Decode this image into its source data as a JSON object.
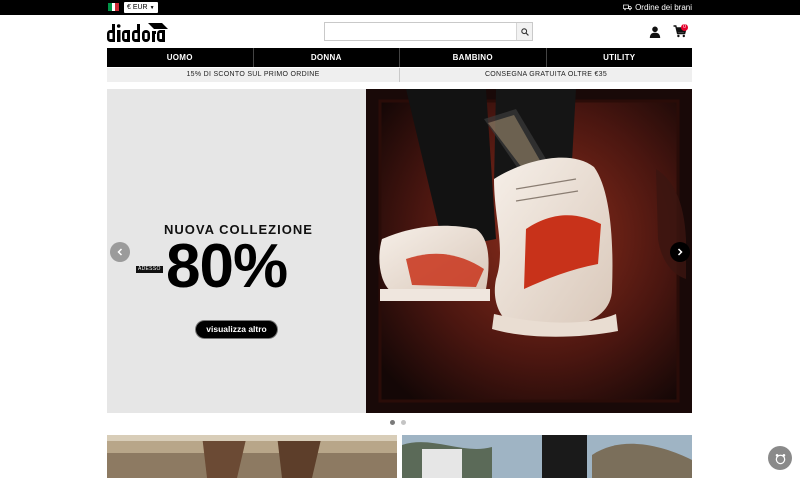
{
  "topbar": {
    "currency": "€ EUR",
    "orders_label": "Ordine dei brani",
    "flag_colors": [
      "#009246",
      "#ffffff",
      "#ce2b37"
    ]
  },
  "header": {
    "logo_alt": "diadora",
    "search_placeholder": "",
    "cart_count": "0"
  },
  "nav": {
    "items": [
      "UOMO",
      "DONNA",
      "BAMBINO",
      "UTILITY"
    ]
  },
  "promo": {
    "items": [
      "15% DI SCONTO SUL PRIMO ORDINE",
      "CONSEGNA GRATUITA OLTRE €35"
    ]
  },
  "hero": {
    "title": "NUOVA COLLEZIONE",
    "now_label": "ADESSO",
    "discount": "80%",
    "cta": "visualizza altro",
    "slides_total": 2,
    "active_slide": 1,
    "accent_color": "#c8321a"
  },
  "icons": {
    "search": "search-icon",
    "user": "user-icon",
    "cart": "cart-icon",
    "truck": "truck-icon",
    "prev": "chevron-left-icon",
    "next": "chevron-right-icon",
    "chat": "chat-icon"
  }
}
